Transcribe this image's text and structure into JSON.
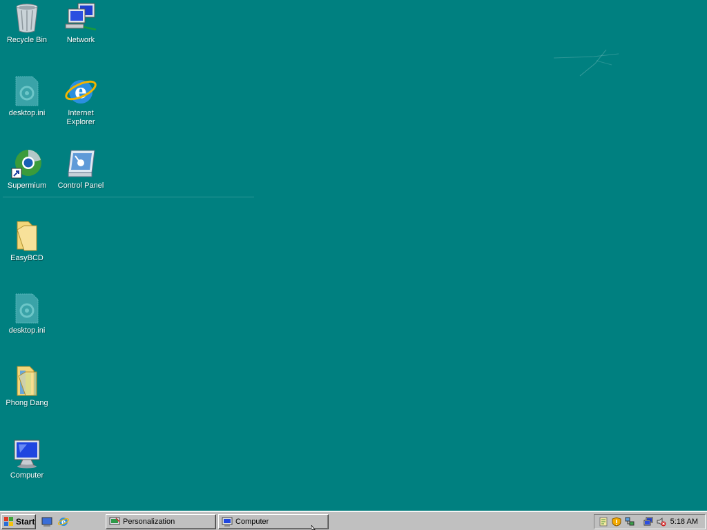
{
  "desktop": {
    "background_color": "#008080",
    "icons": [
      {
        "label": "Recycle Bin",
        "icon": "recycle-bin-icon"
      },
      {
        "label": "Network",
        "icon": "network-icon"
      },
      {
        "label": "desktop.ini",
        "icon": "settings-file-icon"
      },
      {
        "label": "Internet Explorer",
        "icon": "internet-explorer-icon"
      },
      {
        "label": "Supermium",
        "icon": "supermium-browser-icon"
      },
      {
        "label": "Control Panel",
        "icon": "control-panel-icon"
      },
      {
        "label": "EasyBCD",
        "icon": "folder-icon"
      },
      {
        "label": "desktop.ini",
        "icon": "settings-file-icon"
      },
      {
        "label": "Phong Dang",
        "icon": "user-folder-icon"
      },
      {
        "label": "Computer",
        "icon": "computer-icon"
      }
    ]
  },
  "taskbar": {
    "start_label": "Start",
    "quick_launch": [
      "show-desktop-icon",
      "internet-explorer-icon"
    ],
    "tasks": [
      {
        "label": "Personalization",
        "icon": "personalization-icon"
      },
      {
        "label": "Computer",
        "icon": "computer-icon"
      }
    ],
    "tray_icons": [
      "notes-icon",
      "security-alert-icon",
      "network-status-icon",
      "network-connections-icon",
      "volume-muted-icon"
    ],
    "clock": "5:18 AM"
  }
}
